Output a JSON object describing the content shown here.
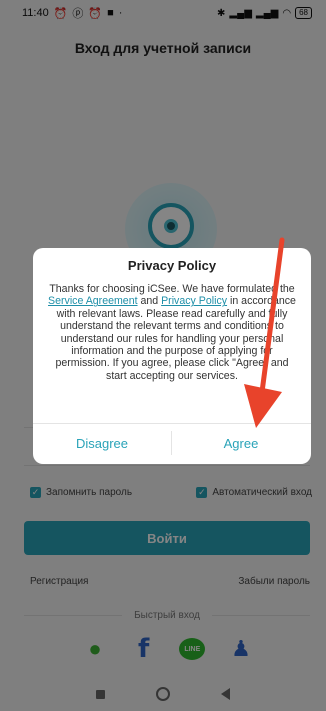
{
  "status_bar": {
    "time": "11:40",
    "icons": [
      "alarm-icon",
      "data-icon",
      "alarm-icon",
      "app-icon"
    ],
    "battery": "68"
  },
  "header": {
    "title": "Вход для учетной записи"
  },
  "background_form": {
    "remember_password": "Запомнить пароль",
    "auto_login": "Автоматический вход",
    "login_button": "Войти",
    "register": "Регистрация",
    "forgot_password": "Забыли пароль",
    "quick_login": "Быстрый вход",
    "social": [
      "wechat-icon",
      "facebook-icon",
      "line-icon",
      "contact-icon"
    ]
  },
  "dialog": {
    "title": "Privacy Policy",
    "body_part1": "Thanks for choosing iCSee. We have formulated the ",
    "link_service": "Service Agreement",
    "body_and": " and ",
    "link_privacy": "Privacy Policy",
    "body_part2": " in accordance with relevant laws. Please read carefully and fully understand the relevant terms and conditions to understand our rules for handling your personal information and the purpose of applying for permission. If you agree, please click \"Agree\" and start accepting our services.",
    "disagree": "Disagree",
    "agree": "Agree"
  },
  "colors": {
    "accent": "#2aa3b8",
    "annotation": "#e8432b"
  }
}
